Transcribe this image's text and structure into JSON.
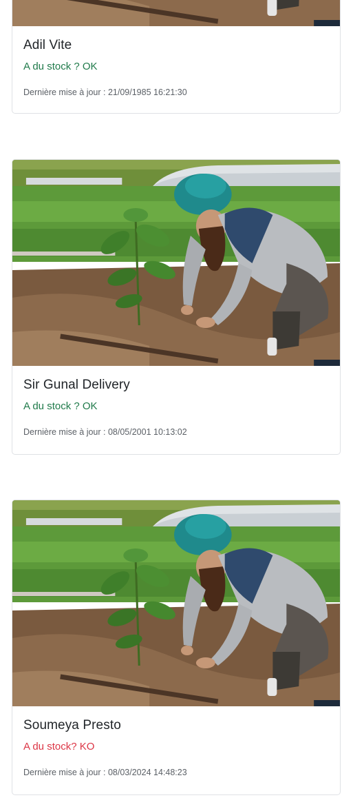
{
  "cards": [
    {
      "name": "Adil Vite",
      "stock": "A du stock ? OK",
      "stock_status": "ok",
      "updated": "Dernière mise à jour : 21/09/1985 16:21:30"
    },
    {
      "name": "Sir Gunal Delivery",
      "stock": "A du stock ? OK",
      "stock_status": "ok",
      "updated": "Dernière mise à jour : 08/05/2001 10:13:02"
    },
    {
      "name": "Soumeya Presto",
      "stock": "A du stock? KO",
      "stock_status": "ko",
      "updated": "Dernière mise à jour : 08/03/2024 14:48:23"
    }
  ],
  "colors": {
    "stock_ok": "#1f7a4a",
    "stock_ko": "#dc3545",
    "title": "#212529",
    "border": "#dfe1e5"
  }
}
